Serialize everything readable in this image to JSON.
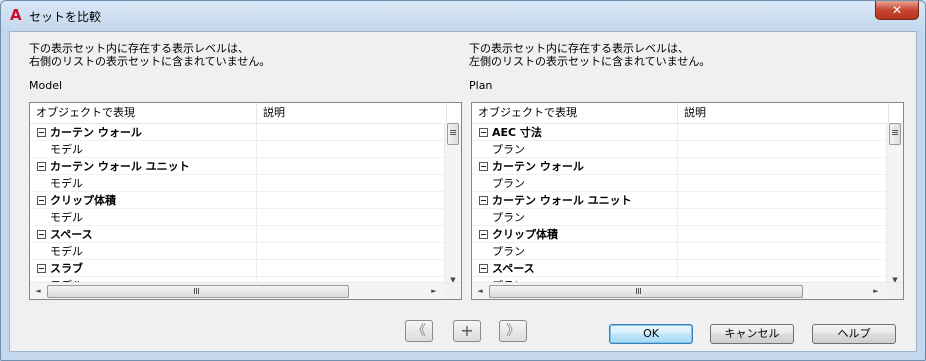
{
  "window": {
    "title": "セットを比較",
    "app_icon": "autocad-a-icon",
    "close_label": "✕"
  },
  "left": {
    "description": "下の表示セット内に存在する表示レベルは、\n右側のリストの表示セットに含まれていません。",
    "set_name": "Model",
    "columns": [
      "オブジェクトで表現",
      "説明"
    ],
    "rows": [
      {
        "type": "group",
        "label": "カーテン ウォール"
      },
      {
        "type": "child",
        "label": "モデル"
      },
      {
        "type": "group",
        "label": "カーテン ウォール ユニット"
      },
      {
        "type": "child",
        "label": "モデル"
      },
      {
        "type": "group",
        "label": "クリップ体積"
      },
      {
        "type": "child",
        "label": "モデル"
      },
      {
        "type": "group",
        "label": "スペース"
      },
      {
        "type": "child",
        "label": "モデル"
      },
      {
        "type": "group",
        "label": "スラブ"
      },
      {
        "type": "child",
        "label": "モデル"
      }
    ]
  },
  "right": {
    "description": "下の表示セット内に存在する表示レベルは、\n左側のリストの表示セットに含まれていません。",
    "set_name": "Plan",
    "columns": [
      "オブジェクトで表現",
      "説明"
    ],
    "rows": [
      {
        "type": "group",
        "label": "AEC 寸法"
      },
      {
        "type": "child",
        "label": "プラン"
      },
      {
        "type": "group",
        "label": "カーテン ウォール"
      },
      {
        "type": "child",
        "label": "プラン"
      },
      {
        "type": "group",
        "label": "カーテン ウォール ユニット"
      },
      {
        "type": "child",
        "label": "プラン"
      },
      {
        "type": "group",
        "label": "クリップ体積"
      },
      {
        "type": "child",
        "label": "プラン"
      },
      {
        "type": "group",
        "label": "スペース"
      },
      {
        "type": "child",
        "label": "プラン"
      }
    ]
  },
  "nav": {
    "prev_label": "《",
    "add_label": "+",
    "next_label": "》"
  },
  "buttons": {
    "ok": "OK",
    "cancel": "キャンセル",
    "help": "ヘルプ"
  }
}
